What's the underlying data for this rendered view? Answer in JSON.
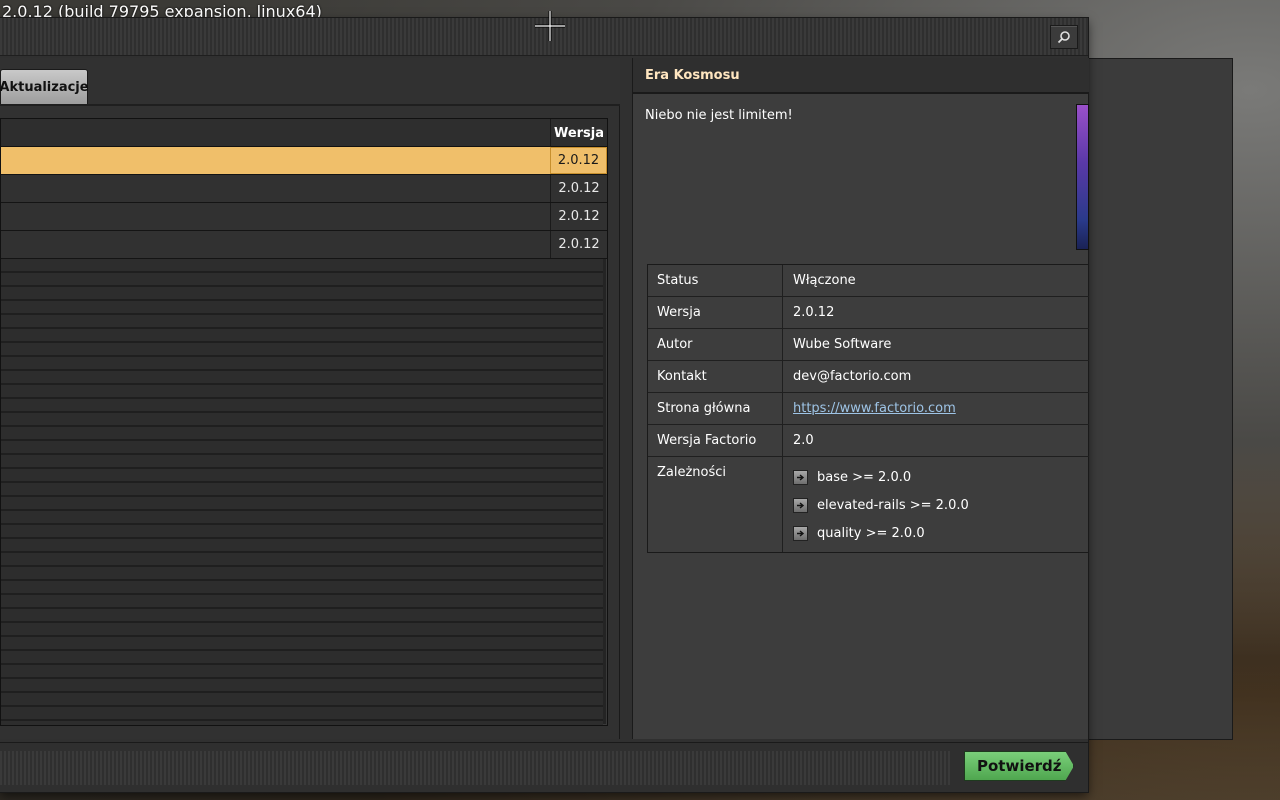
{
  "build_info": "2.0.12 (build 79795 expansion, linux64)",
  "tabs": [
    {
      "label": "Aktualizacje"
    }
  ],
  "mod_table": {
    "version_header": "Wersja",
    "rows": [
      {
        "version": "2.0.12",
        "selected": true
      },
      {
        "version": "2.0.12",
        "selected": false
      },
      {
        "version": "2.0.12",
        "selected": false
      },
      {
        "version": "2.0.12",
        "selected": false
      }
    ]
  },
  "details": {
    "title": "Era Kosmosu",
    "description": "Niebo nie jest limitem!",
    "fields": {
      "status_label": "Status",
      "status_value": "Włączone",
      "version_label": "Wersja",
      "version_value": "2.0.12",
      "author_label": "Autor",
      "author_value": "Wube Software",
      "contact_label": "Kontakt",
      "contact_value": "dev@factorio.com",
      "homepage_label": "Strona główna",
      "homepage_value": "https://www.factorio.com",
      "factorio_version_label": "Wersja Factorio",
      "factorio_version_value": "2.0",
      "dependencies_label": "Zależności"
    },
    "dependencies": [
      "base >= 2.0.0",
      "elevated-rails >= 2.0.0",
      "quality >= 2.0.0"
    ]
  },
  "footer": {
    "confirm_label": "Potwierdź"
  },
  "colors": {
    "selected_row": "#f0bf6a",
    "confirm_button": "#5fbf5f",
    "link": "#9ec4e6"
  },
  "icons": {
    "search": "magnifier-icon",
    "dependency": "arrow-right-icon",
    "cursor": "crosshair-icon"
  }
}
